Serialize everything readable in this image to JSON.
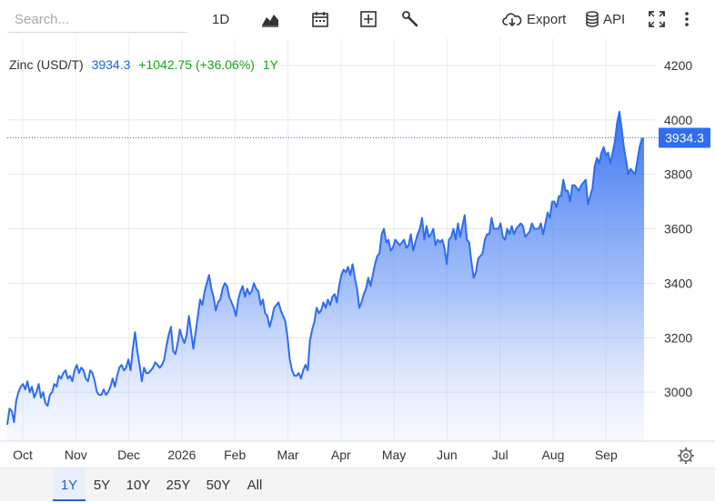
{
  "toolbar": {
    "search_placeholder": "Search...",
    "interval_label": "1D",
    "export_label": "Export",
    "api_label": "API"
  },
  "legend": {
    "symbol": "Zinc (USD/T)",
    "last": "3934.3",
    "change": "+1042.75 (+36.06%)",
    "period": "1Y",
    "colors": {
      "symbol": "#333333",
      "last": "#1c64d6",
      "change": "#1aa31a"
    }
  },
  "price_tag": "3934.3",
  "ranges": [
    "1Y",
    "5Y",
    "10Y",
    "25Y",
    "50Y",
    "All"
  ],
  "active_range": "1Y",
  "chart_data": {
    "type": "area",
    "title": "Zinc (USD/T)",
    "xlabel": "",
    "ylabel": "",
    "x_tick_labels": [
      "Oct",
      "Nov",
      "Dec",
      "2026",
      "Feb",
      "Mar",
      "Apr",
      "May",
      "Jun",
      "Jul",
      "Aug",
      "Sep"
    ],
    "y_ticks": [
      3000,
      3200,
      3400,
      3600,
      3800,
      4000,
      4200
    ],
    "ylim": [
      2820,
      4300
    ],
    "grid": true,
    "color": "#2f6cf0",
    "last_value": 3934.3,
    "series": [
      {
        "values": [
          2880,
          2940,
          2930,
          2890,
          2970,
          3000,
          3020,
          3030,
          3010,
          3040,
          3000,
          3020,
          2980,
          3000,
          3030,
          2980,
          3000,
          2960,
          2950,
          2990,
          3000,
          3030,
          3020,
          3060,
          3050,
          3070,
          3080,
          3050,
          3060,
          3040,
          3080,
          3100,
          3070,
          3090,
          3080,
          3050,
          3040,
          3080,
          3070,
          3040,
          3000,
          2990,
          2990,
          3010,
          2990,
          3000,
          3020,
          3050,
          3020,
          3060,
          3090,
          3100,
          3080,
          3090,
          3120,
          3080,
          3160,
          3220,
          3150,
          3100,
          3040,
          3090,
          3070,
          3070,
          3080,
          3090,
          3110,
          3100,
          3090,
          3100,
          3120,
          3170,
          3210,
          3240,
          3150,
          3140,
          3180,
          3230,
          3200,
          3180,
          3210,
          3280,
          3220,
          3160,
          3220,
          3280,
          3340,
          3320,
          3370,
          3400,
          3430,
          3380,
          3350,
          3300,
          3330,
          3340,
          3380,
          3400,
          3390,
          3350,
          3330,
          3310,
          3280,
          3340,
          3370,
          3390,
          3350,
          3380,
          3360,
          3370,
          3400,
          3380,
          3370,
          3320,
          3340,
          3290,
          3280,
          3240,
          3270,
          3310,
          3320,
          3330,
          3300,
          3280,
          3260,
          3200,
          3120,
          3080,
          3060,
          3060,
          3070,
          3050,
          3080,
          3100,
          3080,
          3190,
          3230,
          3260,
          3310,
          3290,
          3300,
          3330,
          3310,
          3340,
          3320,
          3350,
          3360,
          3330,
          3390,
          3430,
          3450,
          3440,
          3460,
          3430,
          3470,
          3420,
          3380,
          3310,
          3330,
          3360,
          3380,
          3420,
          3390,
          3430,
          3470,
          3500,
          3510,
          3580,
          3600,
          3550,
          3560,
          3520,
          3530,
          3560,
          3550,
          3540,
          3550,
          3560,
          3530,
          3540,
          3580,
          3520,
          3550,
          3580,
          3600,
          3640,
          3560,
          3610,
          3570,
          3580,
          3600,
          3540,
          3560,
          3550,
          3560,
          3530,
          3470,
          3560,
          3570,
          3600,
          3560,
          3620,
          3570,
          3610,
          3650,
          3560,
          3550,
          3480,
          3420,
          3440,
          3490,
          3500,
          3510,
          3560,
          3580,
          3580,
          3640,
          3600,
          3600,
          3600,
          3620,
          3570,
          3560,
          3600,
          3580,
          3610,
          3580,
          3600,
          3610,
          3620,
          3610,
          3570,
          3580,
          3590,
          3620,
          3600,
          3600,
          3600,
          3620,
          3580,
          3620,
          3660,
          3640,
          3700,
          3700,
          3680,
          3720,
          3720,
          3780,
          3740,
          3740,
          3700,
          3760,
          3760,
          3750,
          3740,
          3760,
          3770,
          3780,
          3690,
          3720,
          3750,
          3830,
          3860,
          3840,
          3880,
          3900,
          3870,
          3880,
          3840,
          3880,
          3920,
          3990,
          4030,
          3970,
          3900,
          3850,
          3800,
          3820,
          3810,
          3800,
          3850,
          3900,
          3930,
          3934.3
        ]
      }
    ]
  }
}
